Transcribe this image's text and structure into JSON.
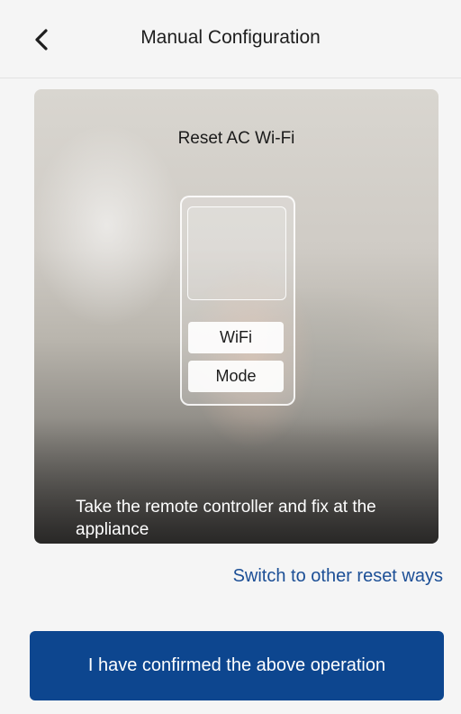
{
  "header": {
    "title": "Manual Configuration",
    "back_icon": "chevron-left-icon"
  },
  "hero": {
    "title": "Reset AC Wi-Fi",
    "remote": {
      "wifi_label": "WiFi",
      "mode_label": "Mode"
    },
    "caption": "Take the remote controller and fix at the appliance"
  },
  "links": {
    "switch_reset": "Switch to other reset ways"
  },
  "footer": {
    "confirm_label": "I have confirmed the above operation"
  },
  "colors": {
    "accent": "#0d468f",
    "link": "#1c4f96",
    "background": "#f5f5f5"
  }
}
